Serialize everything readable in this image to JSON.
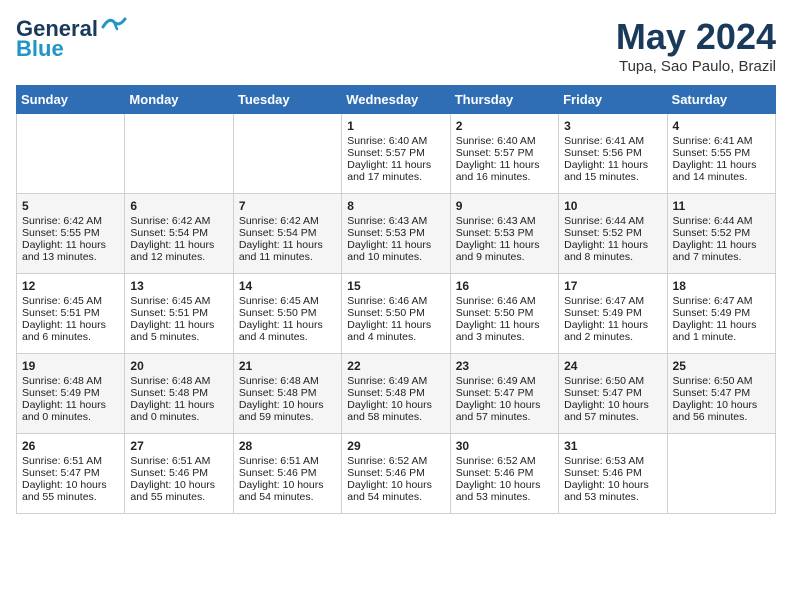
{
  "header": {
    "logo_line1": "General",
    "logo_line2": "Blue",
    "month_title": "May 2024",
    "location": "Tupa, Sao Paulo, Brazil"
  },
  "weekdays": [
    "Sunday",
    "Monday",
    "Tuesday",
    "Wednesday",
    "Thursday",
    "Friday",
    "Saturday"
  ],
  "weeks": [
    [
      {
        "day": "",
        "sunrise": "",
        "sunset": "",
        "daylight": ""
      },
      {
        "day": "",
        "sunrise": "",
        "sunset": "",
        "daylight": ""
      },
      {
        "day": "",
        "sunrise": "",
        "sunset": "",
        "daylight": ""
      },
      {
        "day": "1",
        "sunrise": "Sunrise: 6:40 AM",
        "sunset": "Sunset: 5:57 PM",
        "daylight": "Daylight: 11 hours and 17 minutes."
      },
      {
        "day": "2",
        "sunrise": "Sunrise: 6:40 AM",
        "sunset": "Sunset: 5:57 PM",
        "daylight": "Daylight: 11 hours and 16 minutes."
      },
      {
        "day": "3",
        "sunrise": "Sunrise: 6:41 AM",
        "sunset": "Sunset: 5:56 PM",
        "daylight": "Daylight: 11 hours and 15 minutes."
      },
      {
        "day": "4",
        "sunrise": "Sunrise: 6:41 AM",
        "sunset": "Sunset: 5:55 PM",
        "daylight": "Daylight: 11 hours and 14 minutes."
      }
    ],
    [
      {
        "day": "5",
        "sunrise": "Sunrise: 6:42 AM",
        "sunset": "Sunset: 5:55 PM",
        "daylight": "Daylight: 11 hours and 13 minutes."
      },
      {
        "day": "6",
        "sunrise": "Sunrise: 6:42 AM",
        "sunset": "Sunset: 5:54 PM",
        "daylight": "Daylight: 11 hours and 12 minutes."
      },
      {
        "day": "7",
        "sunrise": "Sunrise: 6:42 AM",
        "sunset": "Sunset: 5:54 PM",
        "daylight": "Daylight: 11 hours and 11 minutes."
      },
      {
        "day": "8",
        "sunrise": "Sunrise: 6:43 AM",
        "sunset": "Sunset: 5:53 PM",
        "daylight": "Daylight: 11 hours and 10 minutes."
      },
      {
        "day": "9",
        "sunrise": "Sunrise: 6:43 AM",
        "sunset": "Sunset: 5:53 PM",
        "daylight": "Daylight: 11 hours and 9 minutes."
      },
      {
        "day": "10",
        "sunrise": "Sunrise: 6:44 AM",
        "sunset": "Sunset: 5:52 PM",
        "daylight": "Daylight: 11 hours and 8 minutes."
      },
      {
        "day": "11",
        "sunrise": "Sunrise: 6:44 AM",
        "sunset": "Sunset: 5:52 PM",
        "daylight": "Daylight: 11 hours and 7 minutes."
      }
    ],
    [
      {
        "day": "12",
        "sunrise": "Sunrise: 6:45 AM",
        "sunset": "Sunset: 5:51 PM",
        "daylight": "Daylight: 11 hours and 6 minutes."
      },
      {
        "day": "13",
        "sunrise": "Sunrise: 6:45 AM",
        "sunset": "Sunset: 5:51 PM",
        "daylight": "Daylight: 11 hours and 5 minutes."
      },
      {
        "day": "14",
        "sunrise": "Sunrise: 6:45 AM",
        "sunset": "Sunset: 5:50 PM",
        "daylight": "Daylight: 11 hours and 4 minutes."
      },
      {
        "day": "15",
        "sunrise": "Sunrise: 6:46 AM",
        "sunset": "Sunset: 5:50 PM",
        "daylight": "Daylight: 11 hours and 4 minutes."
      },
      {
        "day": "16",
        "sunrise": "Sunrise: 6:46 AM",
        "sunset": "Sunset: 5:50 PM",
        "daylight": "Daylight: 11 hours and 3 minutes."
      },
      {
        "day": "17",
        "sunrise": "Sunrise: 6:47 AM",
        "sunset": "Sunset: 5:49 PM",
        "daylight": "Daylight: 11 hours and 2 minutes."
      },
      {
        "day": "18",
        "sunrise": "Sunrise: 6:47 AM",
        "sunset": "Sunset: 5:49 PM",
        "daylight": "Daylight: 11 hours and 1 minute."
      }
    ],
    [
      {
        "day": "19",
        "sunrise": "Sunrise: 6:48 AM",
        "sunset": "Sunset: 5:49 PM",
        "daylight": "Daylight: 11 hours and 0 minutes."
      },
      {
        "day": "20",
        "sunrise": "Sunrise: 6:48 AM",
        "sunset": "Sunset: 5:48 PM",
        "daylight": "Daylight: 11 hours and 0 minutes."
      },
      {
        "day": "21",
        "sunrise": "Sunrise: 6:48 AM",
        "sunset": "Sunset: 5:48 PM",
        "daylight": "Daylight: 10 hours and 59 minutes."
      },
      {
        "day": "22",
        "sunrise": "Sunrise: 6:49 AM",
        "sunset": "Sunset: 5:48 PM",
        "daylight": "Daylight: 10 hours and 58 minutes."
      },
      {
        "day": "23",
        "sunrise": "Sunrise: 6:49 AM",
        "sunset": "Sunset: 5:47 PM",
        "daylight": "Daylight: 10 hours and 57 minutes."
      },
      {
        "day": "24",
        "sunrise": "Sunrise: 6:50 AM",
        "sunset": "Sunset: 5:47 PM",
        "daylight": "Daylight: 10 hours and 57 minutes."
      },
      {
        "day": "25",
        "sunrise": "Sunrise: 6:50 AM",
        "sunset": "Sunset: 5:47 PM",
        "daylight": "Daylight: 10 hours and 56 minutes."
      }
    ],
    [
      {
        "day": "26",
        "sunrise": "Sunrise: 6:51 AM",
        "sunset": "Sunset: 5:47 PM",
        "daylight": "Daylight: 10 hours and 55 minutes."
      },
      {
        "day": "27",
        "sunrise": "Sunrise: 6:51 AM",
        "sunset": "Sunset: 5:46 PM",
        "daylight": "Daylight: 10 hours and 55 minutes."
      },
      {
        "day": "28",
        "sunrise": "Sunrise: 6:51 AM",
        "sunset": "Sunset: 5:46 PM",
        "daylight": "Daylight: 10 hours and 54 minutes."
      },
      {
        "day": "29",
        "sunrise": "Sunrise: 6:52 AM",
        "sunset": "Sunset: 5:46 PM",
        "daylight": "Daylight: 10 hours and 54 minutes."
      },
      {
        "day": "30",
        "sunrise": "Sunrise: 6:52 AM",
        "sunset": "Sunset: 5:46 PM",
        "daylight": "Daylight: 10 hours and 53 minutes."
      },
      {
        "day": "31",
        "sunrise": "Sunrise: 6:53 AM",
        "sunset": "Sunset: 5:46 PM",
        "daylight": "Daylight: 10 hours and 53 minutes."
      },
      {
        "day": "",
        "sunrise": "",
        "sunset": "",
        "daylight": ""
      }
    ]
  ]
}
